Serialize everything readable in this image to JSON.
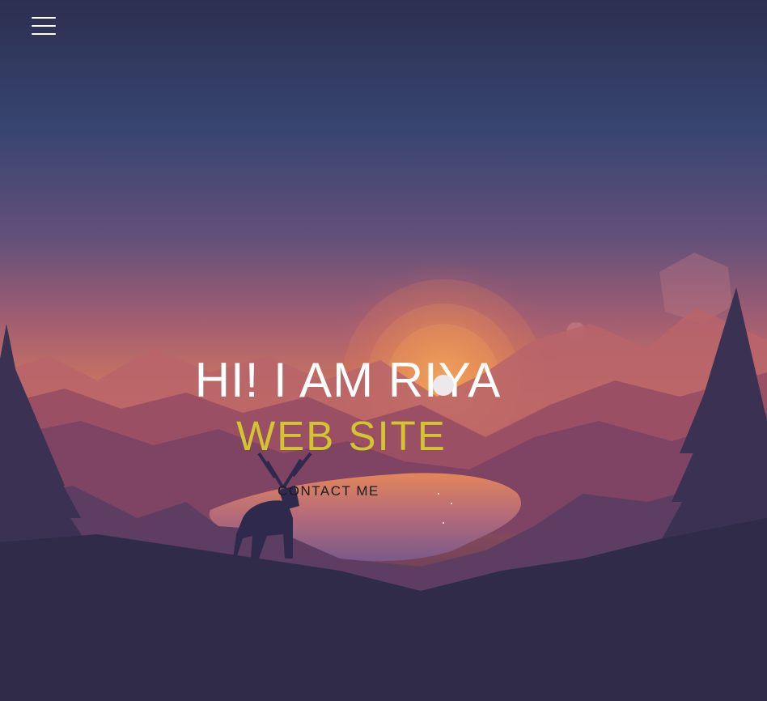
{
  "header": {
    "menu_icon": "hamburger-menu-icon"
  },
  "hero": {
    "title": "HI! I AM RIYA",
    "subtitle": "WEB SITE",
    "cta_label": "CONTACT ME"
  },
  "colors": {
    "title": "#ffffff",
    "subtitle": "#d4c42f",
    "cta": "#1b1a26",
    "sky_top": "#2f3358",
    "sky_mid": "#6a4e78",
    "sun": "#f0a050",
    "ground": "#2d2a45"
  },
  "background": {
    "scene": "sunset-landscape-with-deer",
    "elements": [
      "sunset-sun",
      "mountain-range",
      "lake",
      "pine-trees",
      "deer-silhouette"
    ]
  }
}
